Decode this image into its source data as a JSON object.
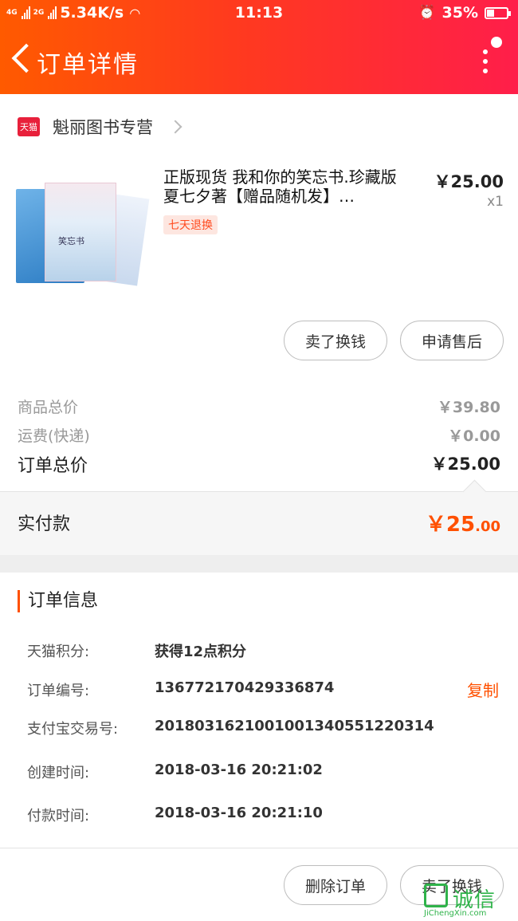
{
  "status_bar": {
    "net_label_1": "4G",
    "net_label_2": "2G",
    "speed": "5.34K/s",
    "time": "11:13",
    "battery": "35%",
    "battery_level": 0.35
  },
  "nav": {
    "title": "订单详情"
  },
  "shop": {
    "badge": "天猫",
    "name": "魁丽图书专营"
  },
  "product": {
    "title": "正版现货 我和你的笑忘书.珍藏版 夏七夕著【赠品随机发】…",
    "cover_text": "笑忘书",
    "tag": "七天退换",
    "price": "￥25.00",
    "qty": "x1"
  },
  "actions": {
    "sell": "卖了换钱",
    "after_sale": "申请售后"
  },
  "summary": {
    "goods_label": "商品总价",
    "goods_value": "￥39.80",
    "shipping_label": "运费(快递)",
    "shipping_value": "￥0.00",
    "total_label": "订单总价",
    "total_value": "￥25.00"
  },
  "paid": {
    "label": "实付款",
    "value_main": "￥25",
    "value_dec": ".00"
  },
  "order_info": {
    "heading": "订单信息",
    "points_label": "天猫积分:",
    "points_value": "获得12点积分",
    "number_label": "订单编号:",
    "number_value": "136772170429336874",
    "copy": "复制",
    "alipay_label": "支付宝交易号:",
    "alipay_value": "2018031621001001340551220314",
    "created_label": "创建时间:",
    "created_value": "2018-03-16 20:21:02",
    "paid_label": "付款时间:",
    "paid_value": "2018-03-16 20:21:10"
  },
  "footer": {
    "delete": "删除订单",
    "sell": "卖了换钱"
  },
  "watermark": {
    "text": "诚信",
    "url": "JiChengXin.com"
  },
  "colors": {
    "accent": "#ff5000",
    "tmall_red": "#e8203b"
  }
}
